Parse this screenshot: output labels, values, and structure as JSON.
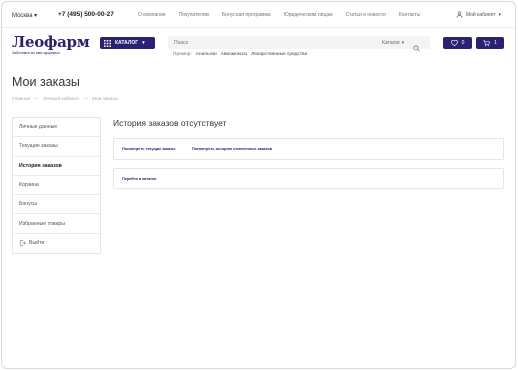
{
  "header": {
    "city": "Москва",
    "phone": "+7 (495) 500-00-27",
    "nav": [
      "О компании",
      "Покупателям",
      "Бонусная программа",
      "Юридическим лицам",
      "Статьи и новости",
      "Контакты"
    ],
    "cabinet": "Мой кабинет"
  },
  "logo": {
    "name": "Леофарм",
    "tagline": "Заботимся во имя здоровья!"
  },
  "catalog_button": "КАТАЛОГ",
  "search": {
    "placeholder": "Поиск",
    "category": "Каталог"
  },
  "examples": {
    "label": "Пример:",
    "items": [
      "Анальгин",
      "Авиомоксиз",
      "Лекарственные средства"
    ]
  },
  "favorites_count": "0",
  "cart_count": "1",
  "page_title": "Мои заказы",
  "breadcrumbs": [
    "Главная",
    "Личный кабинет",
    "Мои заказы"
  ],
  "sidebar": {
    "items": [
      "Личные данные",
      "Текущие заказы",
      "История заказов",
      "Корзина",
      "Бонусы",
      "Избранные товары",
      "Выйти"
    ],
    "active": "История заказов"
  },
  "main": {
    "heading": "История заказов отсутствует",
    "link_current": "Посмотреть текущие заказы",
    "link_cancelled": "Посмотреть историю отмененных заказов",
    "link_catalog": "Перейти в каталог"
  },
  "colors": {
    "brand": "#2a2170",
    "accent": "#e0263a"
  }
}
